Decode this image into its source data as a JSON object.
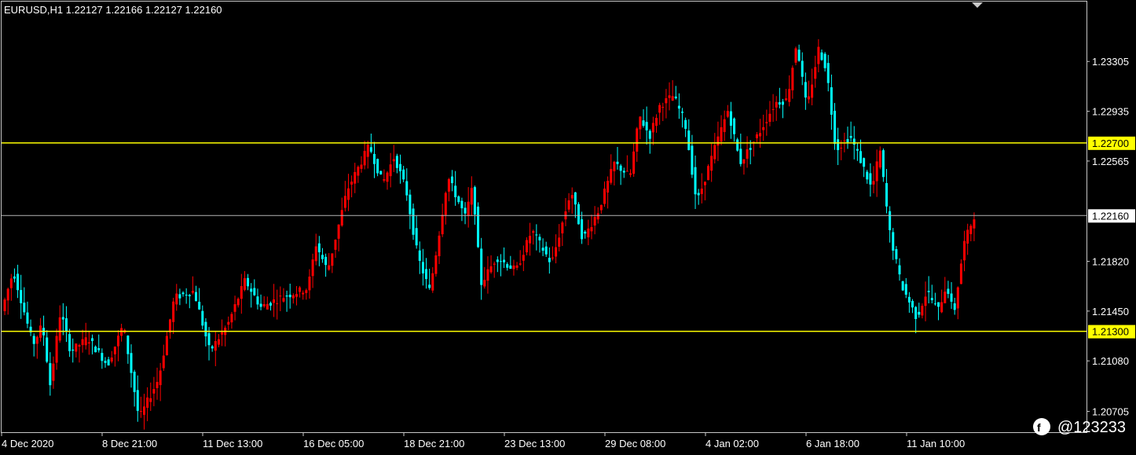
{
  "header": {
    "symbol_line": "EURUSD,H1  1.22127 1.22166 1.22127 1.22160"
  },
  "watermark": {
    "handle": "@123233"
  },
  "colors": {
    "background": "#000000",
    "frame": "#c8c8c8",
    "text": "#ffffff",
    "bull": "#ff0000",
    "bear": "#00ffff",
    "level_line": "#ffff00",
    "bid_line": "#c0c0c0"
  },
  "chart_data": {
    "type": "ohlc_candlestick",
    "symbol": "EURUSD",
    "timeframe": "H1",
    "ylim": [
      1.2055,
      1.2375
    ],
    "y_ticks": [
      "1.23305",
      "1.22935",
      "1.22565",
      "1.21820",
      "1.21450",
      "1.21080",
      "1.20705"
    ],
    "x_ticks": [
      "4 Dec 2020",
      "8 Dec 21:00",
      "11 Dec 13:00",
      "16 Dec 05:00",
      "18 Dec 21:00",
      "23 Dec 13:00",
      "29 Dec 08:00",
      "4 Jan 02:00",
      "6 Jan 18:00",
      "11 Jan 10:00"
    ],
    "horizontal_levels": [
      {
        "price": 1.227,
        "label": "1.22700"
      },
      {
        "price": 1.213,
        "label": "1.21300"
      }
    ],
    "current_price": {
      "price": 1.2216,
      "label": "1.22160"
    },
    "bar_count": 300,
    "price_path": [
      {
        "x": 0,
        "y": 1.2145
      },
      {
        "x": 15,
        "y": 1.2175
      },
      {
        "x": 40,
        "y": 1.212
      },
      {
        "x": 52,
        "y": 1.2135
      },
      {
        "x": 62,
        "y": 1.209
      },
      {
        "x": 75,
        "y": 1.2145
      },
      {
        "x": 88,
        "y": 1.2115
      },
      {
        "x": 110,
        "y": 1.2125
      },
      {
        "x": 135,
        "y": 1.2105
      },
      {
        "x": 155,
        "y": 1.2135
      },
      {
        "x": 175,
        "y": 1.2065
      },
      {
        "x": 200,
        "y": 1.2095
      },
      {
        "x": 220,
        "y": 1.2155
      },
      {
        "x": 245,
        "y": 1.216
      },
      {
        "x": 265,
        "y": 1.2115
      },
      {
        "x": 288,
        "y": 1.2135
      },
      {
        "x": 310,
        "y": 1.2168
      },
      {
        "x": 330,
        "y": 1.2148
      },
      {
        "x": 355,
        "y": 1.2155
      },
      {
        "x": 390,
        "y": 1.2162
      },
      {
        "x": 400,
        "y": 1.2195
      },
      {
        "x": 415,
        "y": 1.2175
      },
      {
        "x": 440,
        "y": 1.2235
      },
      {
        "x": 468,
        "y": 1.2268
      },
      {
        "x": 485,
        "y": 1.224
      },
      {
        "x": 500,
        "y": 1.226
      },
      {
        "x": 515,
        "y": 1.2235
      },
      {
        "x": 530,
        "y": 1.2185
      },
      {
        "x": 545,
        "y": 1.216
      },
      {
        "x": 555,
        "y": 1.2195
      },
      {
        "x": 568,
        "y": 1.2245
      },
      {
        "x": 590,
        "y": 1.2215
      },
      {
        "x": 600,
        "y": 1.2238
      },
      {
        "x": 610,
        "y": 1.2165
      },
      {
        "x": 630,
        "y": 1.2185
      },
      {
        "x": 655,
        "y": 1.2175
      },
      {
        "x": 675,
        "y": 1.2205
      },
      {
        "x": 700,
        "y": 1.218
      },
      {
        "x": 725,
        "y": 1.2235
      },
      {
        "x": 740,
        "y": 1.2198
      },
      {
        "x": 760,
        "y": 1.222
      },
      {
        "x": 780,
        "y": 1.2255
      },
      {
        "x": 800,
        "y": 1.2245
      },
      {
        "x": 812,
        "y": 1.229
      },
      {
        "x": 825,
        "y": 1.2275
      },
      {
        "x": 838,
        "y": 1.2298
      },
      {
        "x": 855,
        "y": 1.2305
      },
      {
        "x": 870,
        "y": 1.2285
      },
      {
        "x": 885,
        "y": 1.2225
      },
      {
        "x": 910,
        "y": 1.227
      },
      {
        "x": 925,
        "y": 1.2295
      },
      {
        "x": 940,
        "y": 1.2255
      },
      {
        "x": 965,
        "y": 1.2278
      },
      {
        "x": 985,
        "y": 1.23
      },
      {
        "x": 1000,
        "y": 1.2302
      },
      {
        "x": 1012,
        "y": 1.2345
      },
      {
        "x": 1025,
        "y": 1.2295
      },
      {
        "x": 1040,
        "y": 1.234
      },
      {
        "x": 1050,
        "y": 1.2325
      },
      {
        "x": 1062,
        "y": 1.2265
      },
      {
        "x": 1080,
        "y": 1.2275
      },
      {
        "x": 1095,
        "y": 1.2255
      },
      {
        "x": 1108,
        "y": 1.2235
      },
      {
        "x": 1118,
        "y": 1.2265
      },
      {
        "x": 1130,
        "y": 1.2205
      },
      {
        "x": 1145,
        "y": 1.2165
      },
      {
        "x": 1165,
        "y": 1.214
      },
      {
        "x": 1178,
        "y": 1.216
      },
      {
        "x": 1192,
        "y": 1.2145
      },
      {
        "x": 1203,
        "y": 1.2165
      },
      {
        "x": 1212,
        "y": 1.2142
      },
      {
        "x": 1225,
        "y": 1.2195
      },
      {
        "x": 1238,
        "y": 1.2216
      }
    ]
  }
}
